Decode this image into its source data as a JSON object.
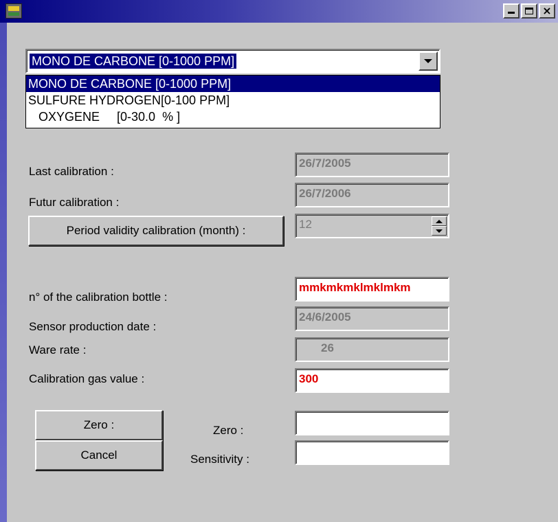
{
  "window": {
    "title": "",
    "controls": {
      "minimize": "minimize-icon",
      "maximize": "maximize-icon",
      "close": "close-icon"
    }
  },
  "sensor_select": {
    "selected": "MONO DE CARBONE [0-1000 PPM]",
    "options": [
      "MONO DE CARBONE [0-1000 PPM]",
      "SULFURE HYDROGEN[0-100 PPM]",
      "   OXYGENE     [0-30.0  % ]"
    ]
  },
  "labels": {
    "last_calibration": "Last calibration :",
    "futur_calibration": "Futur calibration :",
    "bottle_number": "n° of the calibration bottle :",
    "production_date": "Sensor production date :",
    "ware_rate": "Ware rate :",
    "gas_value": "Calibration gas value :",
    "zero": "Zero :",
    "sensitivity": "Sensitivity :"
  },
  "values": {
    "last_calibration": "26/7/2005",
    "futur_calibration": "26/7/2006",
    "period_validity": "12",
    "bottle_number": "mmkmkmklmklmkm",
    "production_date": "24/6/2005",
    "ware_rate": "26",
    "gas_value": "300",
    "zero": "",
    "sensitivity": ""
  },
  "buttons": {
    "period_validity": "Period validity calibration (month) :",
    "zero": "Zero :",
    "cancel": "Cancel"
  },
  "colors": {
    "title_start": "#000080",
    "highlight": "#000080",
    "error_text": "#e00000",
    "disabled_text": "#7a7a7a"
  }
}
